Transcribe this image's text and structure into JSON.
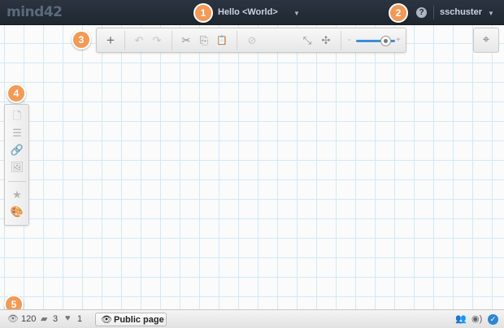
{
  "app": {
    "logo": "mind42"
  },
  "header": {
    "doc_title": "Hello <World>",
    "help_icon": "help-icon",
    "username": "sschuster"
  },
  "callouts": [
    "1",
    "2",
    "3",
    "4",
    "5"
  ],
  "toolbar": {
    "buttons": [
      {
        "name": "add-node",
        "glyph": "+"
      },
      {
        "name": "undo",
        "glyph": "↶"
      },
      {
        "name": "redo",
        "glyph": "↷"
      },
      {
        "name": "cut",
        "glyph": "✂"
      },
      {
        "name": "copy",
        "glyph": "⎘"
      },
      {
        "name": "paste",
        "glyph": "📋"
      },
      {
        "name": "delete",
        "glyph": "⊘"
      },
      {
        "name": "collapse",
        "glyph": "⤡"
      },
      {
        "name": "expand",
        "glyph": "✣"
      }
    ],
    "zoom": {
      "minus": "-",
      "plus": "+",
      "level": 0.75
    },
    "center_glyph": "⌖"
  },
  "sidebar": {
    "buttons": [
      {
        "name": "note",
        "glyph": "🗋"
      },
      {
        "name": "list",
        "glyph": "☰"
      },
      {
        "name": "link",
        "glyph": "🔗"
      },
      {
        "name": "image",
        "glyph": "🖼"
      },
      {
        "name": "favorite",
        "glyph": "★"
      },
      {
        "name": "palette",
        "glyph": "🎨"
      }
    ]
  },
  "status": {
    "views": "120",
    "comments": "3",
    "likes": "1",
    "public_button": "Public page"
  },
  "colors": {
    "accent": "#f39a56",
    "topbar": "#232b35",
    "link": "#2f86d4"
  }
}
